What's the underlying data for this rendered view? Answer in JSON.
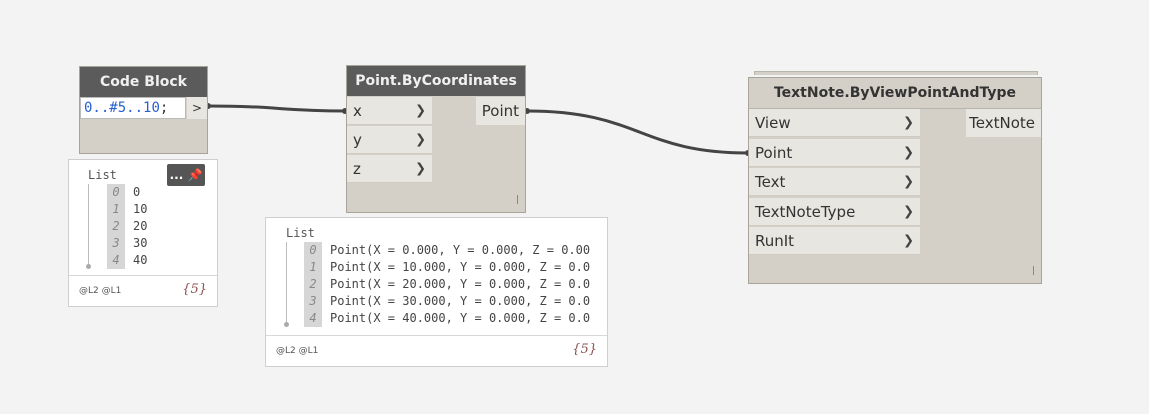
{
  "colors": {
    "canvas": "#f3f3f3",
    "node_body": "#d4d0c8",
    "node_header": "#5b5b5b",
    "wire": "#444444",
    "code_blue": "#2a5fcf"
  },
  "code_block": {
    "title": "Code Block",
    "code_prefix": "0..#5..",
    "code_num": "10",
    "code_suffix": ";",
    "output_port": ">",
    "preview": {
      "list_title": "List",
      "pin_button": "... 📌",
      "items": [
        {
          "index": "0",
          "value": "0"
        },
        {
          "index": "1",
          "value": "10"
        },
        {
          "index": "2",
          "value": "20"
        },
        {
          "index": "3",
          "value": "30"
        },
        {
          "index": "4",
          "value": "40"
        }
      ],
      "levels": "@L2 @L1",
      "count": "{5}"
    }
  },
  "point_node": {
    "title": "Point.ByCoordinates",
    "inputs": [
      "x",
      "y",
      "z"
    ],
    "output": "Point",
    "preview": {
      "list_title": "List",
      "items": [
        {
          "index": "0",
          "value": "Point(X = 0.000, Y = 0.000, Z = 0.00"
        },
        {
          "index": "1",
          "value": "Point(X = 10.000, Y = 0.000, Z = 0.0"
        },
        {
          "index": "2",
          "value": "Point(X = 20.000, Y = 0.000, Z = 0.0"
        },
        {
          "index": "3",
          "value": "Point(X = 30.000, Y = 0.000, Z = 0.0"
        },
        {
          "index": "4",
          "value": "Point(X = 40.000, Y = 0.000, Z = 0.0"
        }
      ],
      "levels": "@L2 @L1",
      "count": "{5}"
    }
  },
  "textnote_node": {
    "title": "TextNote.ByViewPointAndType",
    "inputs": [
      "View",
      "Point",
      "Text",
      "TextNoteType",
      "RunIt"
    ],
    "output": "TextNote"
  },
  "chevron": "❯"
}
